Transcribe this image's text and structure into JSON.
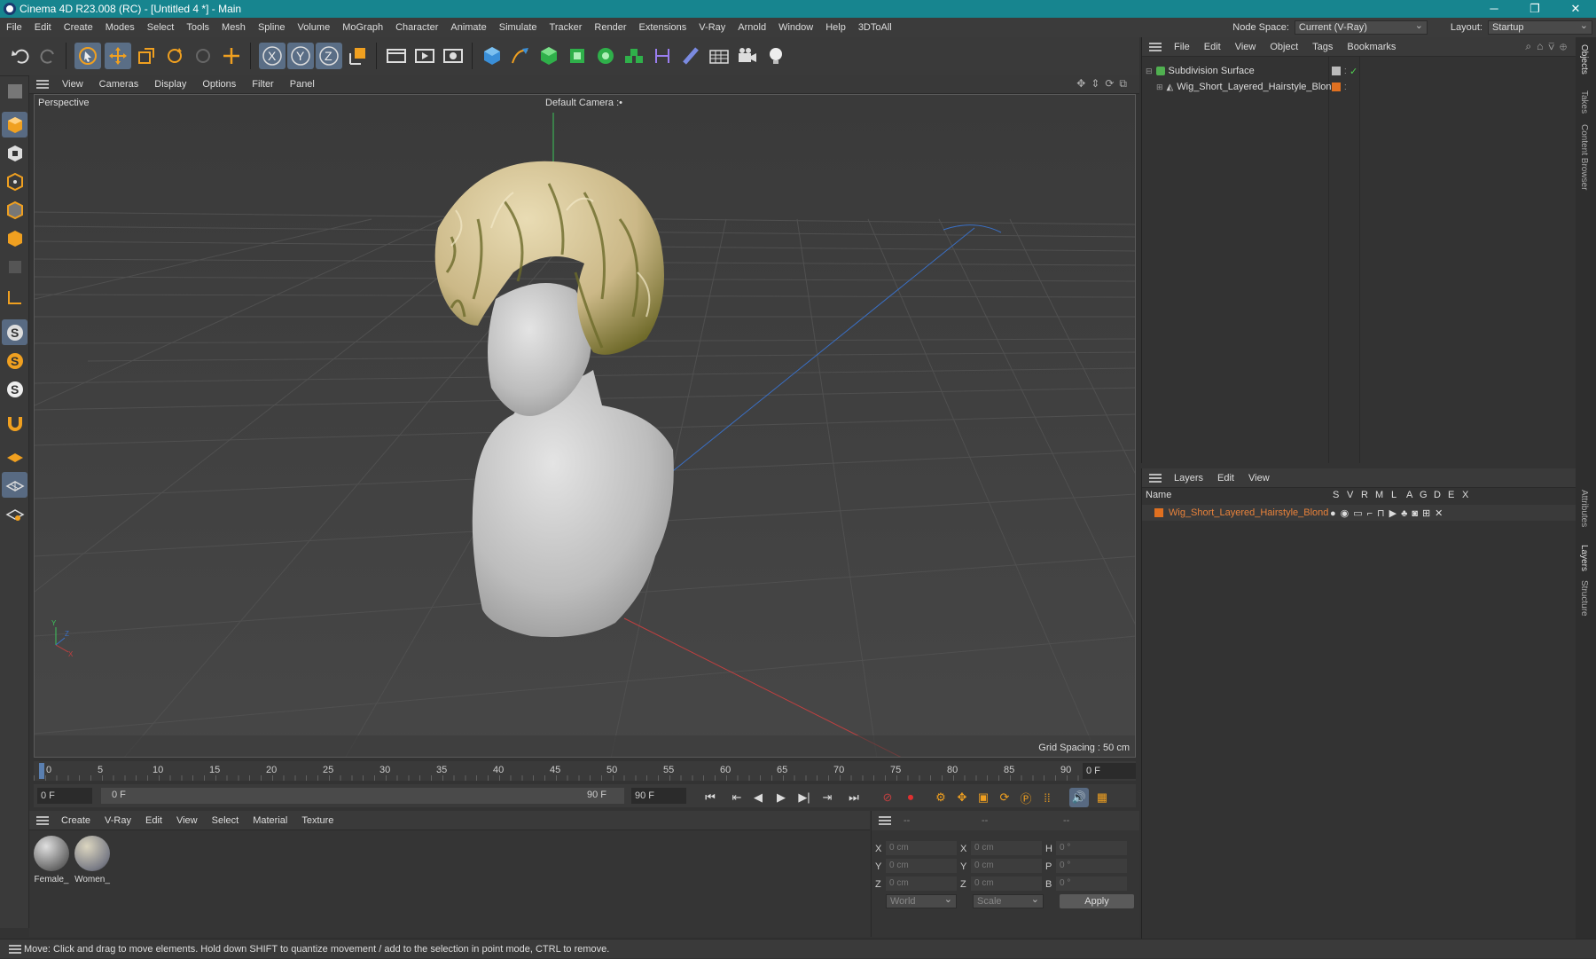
{
  "window": {
    "title": "Cinema 4D R23.008 (RC) - [Untitled 4 *] - Main",
    "min": "─",
    "max": "❐",
    "close": "✕"
  },
  "menu": [
    "File",
    "Edit",
    "Create",
    "Modes",
    "Select",
    "Tools",
    "Mesh",
    "Spline",
    "Volume",
    "MoGraph",
    "Character",
    "Animate",
    "Simulate",
    "Tracker",
    "Render",
    "Extensions",
    "V-Ray",
    "Arnold",
    "Window",
    "Help",
    "3DToAll"
  ],
  "nodespace": {
    "label": "Node Space:",
    "value": "Current (V-Ray)"
  },
  "layout": {
    "label": "Layout:",
    "value": "Startup"
  },
  "viewport_menu": [
    "View",
    "Cameras",
    "Display",
    "Options",
    "Filter",
    "Panel"
  ],
  "viewport": {
    "name": "Perspective",
    "camera": "Default Camera :•",
    "grid_spacing": "Grid Spacing : 50 cm"
  },
  "timeline": {
    "ticks": [
      "0",
      "5",
      "10",
      "15",
      "20",
      "25",
      "30",
      "35",
      "40",
      "45",
      "50",
      "55",
      "60",
      "65",
      "70",
      "75",
      "80",
      "85",
      "90"
    ],
    "frame": "0 F"
  },
  "transport": {
    "start": "0 F",
    "range_start": "0 F",
    "range_end": "90 F",
    "end": "90 F"
  },
  "material_menu": [
    "Create",
    "V-Ray",
    "Edit",
    "View",
    "Select",
    "Material",
    "Texture"
  ],
  "materials": [
    {
      "name": "Female_",
      "color": "#9a9a9a"
    },
    {
      "name": "Women_",
      "color": "#8a8e96"
    }
  ],
  "coords": {
    "header": [
      "--",
      "--",
      "--"
    ],
    "rows": [
      {
        "l1": "X",
        "v1": "0 cm",
        "l2": "X",
        "v2": "0 cm",
        "l3": "H",
        "v3": "0 °"
      },
      {
        "l1": "Y",
        "v1": "0 cm",
        "l2": "Y",
        "v2": "0 cm",
        "l3": "P",
        "v3": "0 °"
      },
      {
        "l1": "Z",
        "v1": "0 cm",
        "l2": "Z",
        "v2": "0 cm",
        "l3": "B",
        "v3": "0 °"
      }
    ],
    "world": "World",
    "scale": "Scale",
    "apply": "Apply"
  },
  "status": "Move: Click and drag to move elements. Hold down SHIFT to quantize movement / add to the selection in point mode, CTRL to remove.",
  "objects_menu": [
    "File",
    "Edit",
    "View",
    "Object",
    "Tags",
    "Bookmarks"
  ],
  "objects": [
    {
      "name": "Subdivision Surface",
      "color": "#50b050"
    },
    {
      "name": "Wig_Short_Layered_Hairstyle_Blond",
      "color": "#e07020"
    }
  ],
  "layers_menu": [
    "Layers",
    "Edit",
    "View"
  ],
  "layers_header": {
    "name": "Name",
    "cols": [
      "S",
      "V",
      "R",
      "M",
      "L",
      "A",
      "G",
      "D",
      "E",
      "X"
    ]
  },
  "layers": [
    {
      "name": "Wig_Short_Layered_Hairstyle_Blond",
      "color": "#e07020"
    }
  ],
  "side_tabs": [
    "Objects",
    "Takes",
    "Content Browser",
    "Attributes",
    "Layers",
    "Structure"
  ]
}
